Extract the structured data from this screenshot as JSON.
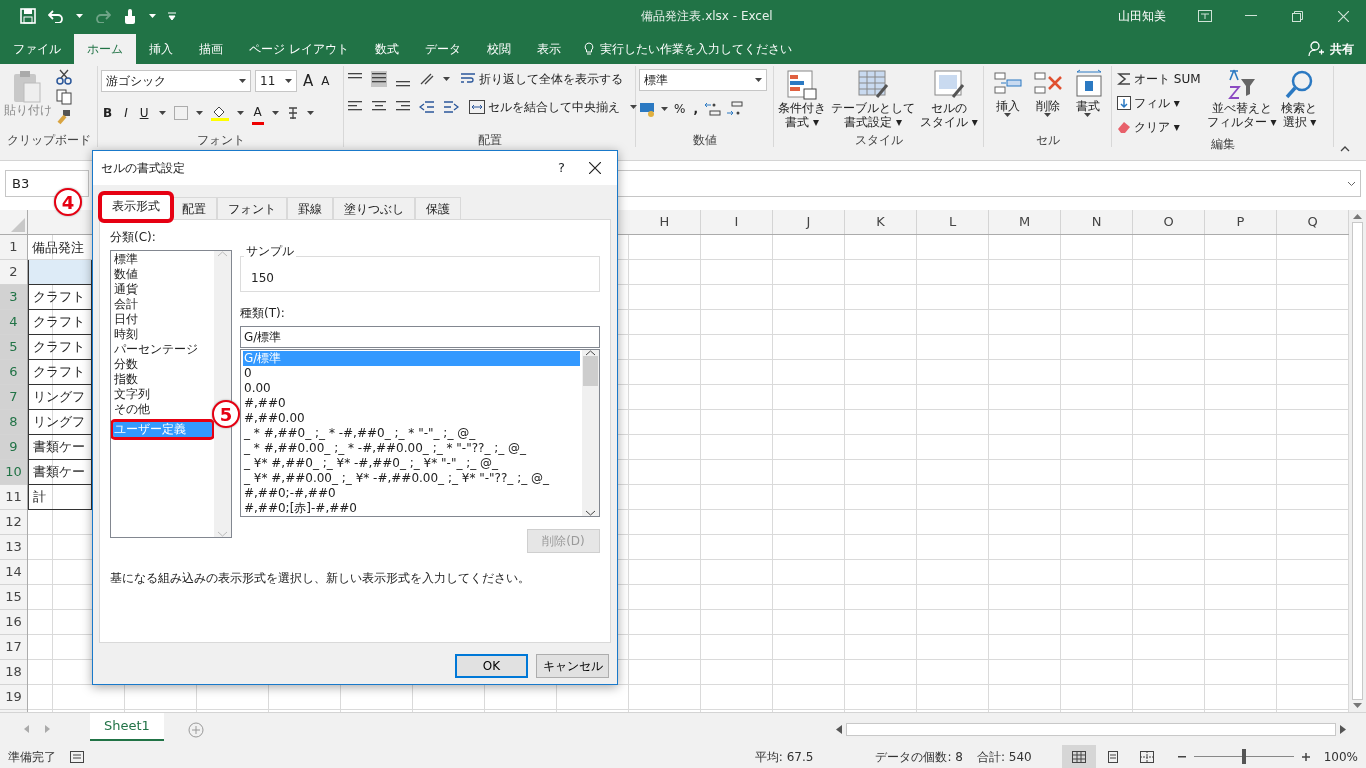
{
  "window": {
    "title": "備品発注表.xlsx  -  Excel",
    "user": "山田知美"
  },
  "menu_tabs": [
    {
      "label": "ファイル",
      "selected": false
    },
    {
      "label": "ホーム",
      "selected": true
    },
    {
      "label": "挿入",
      "selected": false
    },
    {
      "label": "描画",
      "selected": false
    },
    {
      "label": "ページ レイアウト",
      "selected": false
    },
    {
      "label": "数式",
      "selected": false
    },
    {
      "label": "データ",
      "selected": false
    },
    {
      "label": "校閲",
      "selected": false
    },
    {
      "label": "表示",
      "selected": false
    }
  ],
  "tell_me": "実行したい作業を入力してください",
  "share": "共有",
  "ribbon": {
    "clipboard": {
      "paste": "貼り付け",
      "label": "クリップボード"
    },
    "font": {
      "face": "游ゴシック",
      "size": "11",
      "grow": "A",
      "shrink": "A",
      "bold": "B",
      "italic": "I",
      "underline": "U",
      "font_color": "A",
      "label": "フォント"
    },
    "alignment": {
      "wrap": "折り返して全体を表示する",
      "merge": "セルを結合して中央揃え",
      "label": "配置"
    },
    "number": {
      "format": "標準",
      "percent": "%",
      "comma": ",",
      "label": "数値"
    },
    "styles": {
      "buttons": [
        {
          "lines": [
            "条件付き",
            "書式 ▾"
          ]
        },
        {
          "lines": [
            "テーブルとして",
            "書式設定 ▾"
          ]
        },
        {
          "lines": [
            "セルの",
            "スタイル ▾"
          ]
        }
      ],
      "label": "スタイル"
    },
    "cells": {
      "buttons": [
        "挿入",
        "削除",
        "書式"
      ],
      "label": "セル"
    },
    "editing": {
      "autosum": "オート SUM",
      "fill": "フィル ▾",
      "clear": "クリア ▾",
      "sort": [
        "並べ替えと",
        "フィルター ▾"
      ],
      "find": [
        "検索と",
        "選択 ▾"
      ],
      "label": "編集"
    }
  },
  "name_box": "B3",
  "sheet": {
    "columns": [
      "H",
      "I",
      "J",
      "K",
      "L",
      "M",
      "N",
      "O",
      "P",
      "Q"
    ],
    "rows": [
      {
        "number": "1",
        "selected": false,
        "cell_a": "備品発注",
        "bordered": false,
        "shaded": false
      },
      {
        "number": "2",
        "selected": false,
        "bordered": true,
        "shaded": true
      },
      {
        "number": "3",
        "selected": true,
        "cell_a": "クラフト",
        "bordered": true,
        "shaded": false
      },
      {
        "number": "4",
        "selected": true,
        "cell_a": "クラフト",
        "bordered": true,
        "shaded": false
      },
      {
        "number": "5",
        "selected": true,
        "cell_a": "クラフト",
        "bordered": true,
        "shaded": false
      },
      {
        "number": "6",
        "selected": true,
        "cell_a": "クラフト",
        "bordered": true,
        "shaded": false
      },
      {
        "number": "7",
        "selected": true,
        "cell_a": "リングフ",
        "bordered": true,
        "shaded": false
      },
      {
        "number": "8",
        "selected": true,
        "cell_a": "リングフ",
        "bordered": true,
        "shaded": false
      },
      {
        "number": "9",
        "selected": true,
        "cell_a": "書類ケー",
        "bordered": true,
        "shaded": false
      },
      {
        "number": "10",
        "selected": true,
        "cell_a": "書類ケー",
        "bordered": true,
        "shaded": false
      },
      {
        "number": "11",
        "selected": false,
        "cell_a": "計",
        "bordered": true,
        "shaded": false
      },
      {
        "number": "12",
        "selected": false,
        "bordered": false,
        "shaded": false
      },
      {
        "number": "13",
        "selected": false,
        "bordered": false,
        "shaded": false
      },
      {
        "number": "14",
        "selected": false,
        "bordered": false,
        "shaded": false
      },
      {
        "number": "15",
        "selected": false,
        "bordered": false,
        "shaded": false
      },
      {
        "number": "16",
        "selected": false,
        "bordered": false,
        "shaded": false
      },
      {
        "number": "17",
        "selected": false,
        "bordered": false,
        "shaded": false
      },
      {
        "number": "18",
        "selected": false,
        "bordered": false,
        "shaded": false
      },
      {
        "number": "19",
        "selected": false,
        "bordered": false,
        "shaded": false
      }
    ]
  },
  "dialog": {
    "title": "セルの書式設定",
    "help": "?",
    "tabs": [
      {
        "label": "表示形式",
        "selected": true,
        "highlighted": true
      },
      {
        "label": "配置",
        "selected": false,
        "highlighted": false
      },
      {
        "label": "フォント",
        "selected": false,
        "highlighted": false
      },
      {
        "label": "罫線",
        "selected": false,
        "highlighted": false
      },
      {
        "label": "塗りつぶし",
        "selected": false,
        "highlighted": false
      },
      {
        "label": "保護",
        "selected": false,
        "highlighted": false
      }
    ],
    "category_label": "分類(C):",
    "categories": [
      {
        "label": "標準",
        "selected": false,
        "highlighted": false
      },
      {
        "label": "数値",
        "selected": false,
        "highlighted": false
      },
      {
        "label": "通貨",
        "selected": false,
        "highlighted": false
      },
      {
        "label": "会計",
        "selected": false,
        "highlighted": false
      },
      {
        "label": "日付",
        "selected": false,
        "highlighted": false
      },
      {
        "label": "時刻",
        "selected": false,
        "highlighted": false
      },
      {
        "label": "パーセンテージ",
        "selected": false,
        "highlighted": false
      },
      {
        "label": "分数",
        "selected": false,
        "highlighted": false
      },
      {
        "label": "指数",
        "selected": false,
        "highlighted": false
      },
      {
        "label": "文字列",
        "selected": false,
        "highlighted": false
      },
      {
        "label": "その他",
        "selected": false,
        "highlighted": false
      },
      {
        "label": "ユーザー定義",
        "selected": true,
        "highlighted": true
      }
    ],
    "sample_label": "サンプル",
    "sample": "150",
    "type_label": "種類(T):",
    "type_value": "G/標準",
    "formats": [
      {
        "label": "G/標準",
        "selected": true
      },
      {
        "label": "0",
        "selected": false
      },
      {
        "label": "0.00",
        "selected": false
      },
      {
        "label": "#,##0",
        "selected": false
      },
      {
        "label": "#,##0.00",
        "selected": false
      },
      {
        "label": "_ * #,##0_ ;_ * -#,##0_ ;_ * \"-\"_ ;_ @_",
        "selected": false
      },
      {
        "label": "_ * #,##0.00_ ;_ * -#,##0.00_ ;_ * \"-\"??_ ;_ @_",
        "selected": false
      },
      {
        "label": "_ ¥* #,##0_ ;_ ¥* -#,##0_ ;_ ¥* \"-\"_ ;_ @_",
        "selected": false
      },
      {
        "label": "_ ¥* #,##0.00_ ;_ ¥* -#,##0.00_ ;_ ¥* \"-\"??_ ;_ @_",
        "selected": false
      },
      {
        "label": "#,##0;-#,##0",
        "selected": false
      },
      {
        "label": "#,##0;[赤]-#,##0",
        "selected": false
      }
    ],
    "delete": {
      "label": "削除(D)",
      "disabled": true
    },
    "description": "基になる組み込みの表示形式を選択し、新しい表示形式を入力してください。",
    "ok": "OK",
    "cancel": "キャンセル"
  },
  "callouts": [
    {
      "number": "4"
    },
    {
      "number": "5"
    }
  ],
  "sheet_tabs": [
    {
      "label": "Sheet1",
      "selected": true
    }
  ],
  "status_bar": {
    "mode": "準備完了",
    "average": "平均: 67.5",
    "count": "データの個数: 8",
    "sum": "合計: 540",
    "views": [
      {
        "kind": "normal",
        "selected": true
      },
      {
        "kind": "layout",
        "selected": false
      },
      {
        "kind": "pagebreak",
        "selected": false
      }
    ],
    "zoom_slider": {
      "level": 0.5
    },
    "zoom": "100%"
  }
}
